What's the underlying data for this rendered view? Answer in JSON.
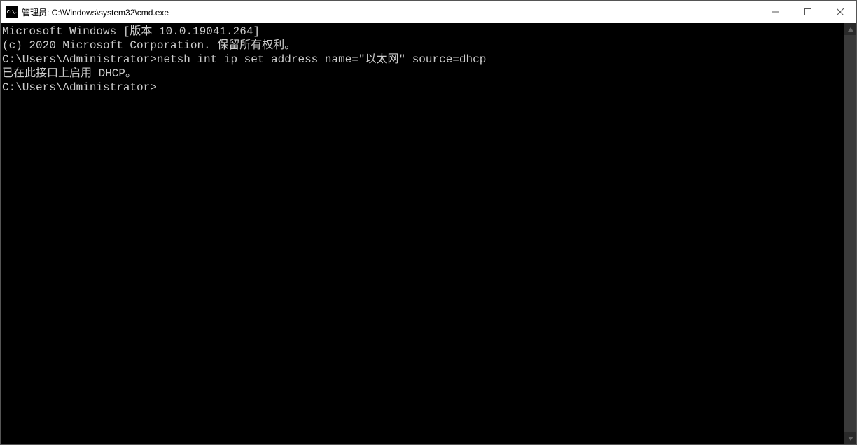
{
  "titlebar": {
    "icon_label": "C:\\.",
    "title": "管理员: C:\\Windows\\system32\\cmd.exe"
  },
  "terminal": {
    "line1": "Microsoft Windows [版本 10.0.19041.264]",
    "line2": "(c) 2020 Microsoft Corporation. 保留所有权利。",
    "blank1": "",
    "line3_prompt": "C:\\Users\\Administrator>",
    "line3_cmd": "netsh int ip set address name=\"以太网\" source=dhcp",
    "line4": "已在此接口上启用 DHCP。",
    "blank2": "",
    "blank3": "",
    "line5_prompt": "C:\\Users\\Administrator>"
  }
}
